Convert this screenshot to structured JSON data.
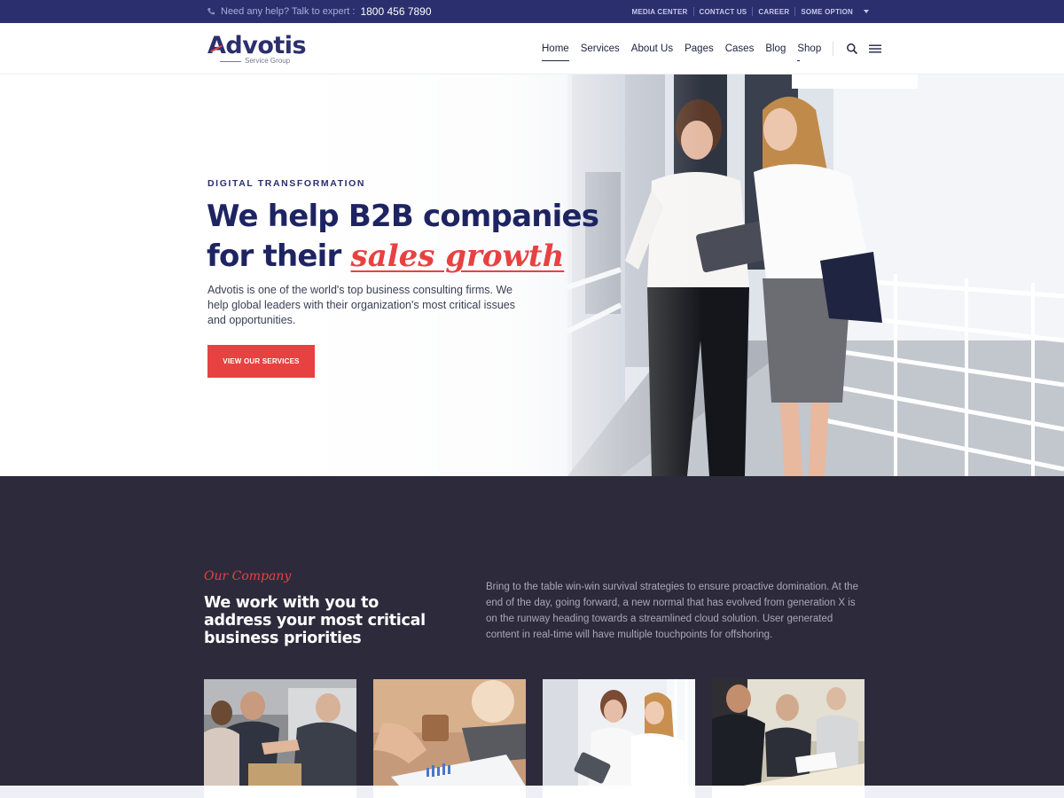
{
  "topbar": {
    "help_text": "Need any help? Talk to expert :",
    "phone": "1800 456 7890",
    "links": [
      "MEDIA CENTER",
      "CONTACT US",
      "CAREER",
      "SOME OPTION"
    ]
  },
  "header": {
    "logo_text": "Advotis",
    "logo_sub": "Service Group",
    "nav": [
      "Home",
      "Services",
      "About Us",
      "Pages",
      "Cases",
      "Blog",
      "Shop"
    ],
    "icons": [
      "search-icon",
      "menu-icon"
    ]
  },
  "hero": {
    "eyebrow": "DIGITAL TRANSFORMATION",
    "headline_1": "We help B2B companies",
    "headline_2": "for their",
    "headline_accent": "sales growth",
    "lead": "Advotis is one of the world's top business consulting firms. We help global leaders with their organization's most critical issues and opportunities.",
    "cta": "VIEW OUR SERVICES"
  },
  "company": {
    "kicker": "Our Company",
    "title": "We work with you to address your most critical business priorities",
    "paragraph": "Bring to the table win-win survival strategies to ensure proactive domination. At the end of the day, going forward, a new normal that has evolved from generation X is on the runway heading towards a streamlined cloud solution. User generated content in real-time will have multiple touchpoints for offshoring."
  },
  "colors": {
    "navy": "#2b2f6e",
    "accent": "#e84141",
    "dark_section": "#2d2b3b"
  }
}
